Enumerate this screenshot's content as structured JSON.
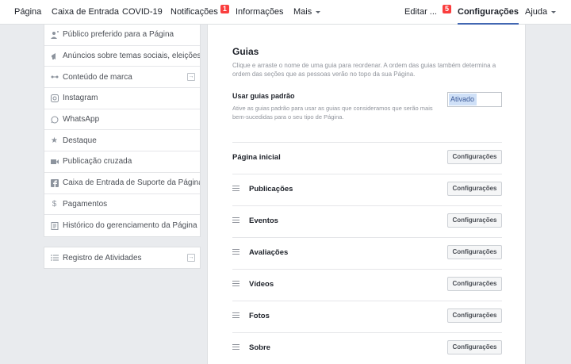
{
  "topnav": {
    "items": [
      {
        "label": "Página"
      },
      {
        "label": "Caixa de Entrada"
      },
      {
        "label": "COVID-19"
      },
      {
        "label": "Notificações",
        "badge": "1"
      },
      {
        "label": "Informações"
      },
      {
        "label": "Mais"
      }
    ],
    "right": [
      {
        "label": "Editar ...",
        "badge": "5"
      },
      {
        "label": "Configurações"
      },
      {
        "label": "Ajuda"
      }
    ]
  },
  "sidebar": {
    "items": [
      {
        "label": "Público preferido para a Página",
        "icon": "audience-icon"
      },
      {
        "label": "Anúncios sobre temas sociais, eleições ou política",
        "icon": "megaphone-icon"
      },
      {
        "label": "Conteúdo de marca",
        "icon": "handshake-icon"
      },
      {
        "label": "Instagram",
        "icon": "instagram-icon"
      },
      {
        "label": "WhatsApp",
        "icon": "whatsapp-icon"
      },
      {
        "label": "Destaque",
        "icon": "star-icon"
      },
      {
        "label": "Publicação cruzada",
        "icon": "video-icon"
      },
      {
        "label": "Caixa de Entrada de Suporte da Página",
        "icon": "facebook-icon"
      },
      {
        "label": "Pagamentos",
        "icon": "dollar-icon"
      },
      {
        "label": "Histórico do gerenciamento da Página",
        "icon": "history-icon"
      }
    ],
    "activity": {
      "label": "Registro de Atividades",
      "icon": "list-icon"
    }
  },
  "main": {
    "title": "Guias",
    "description": "Clique e arraste o nome de uma guia para reordenar. A ordem das guias também determina a ordem das seções que as pessoas verão no topo da sua Página.",
    "standard_tabs": {
      "title": "Usar guias padrão",
      "description": "Ative as guias padrão para usar as guias que consideramos que serão mais bem-sucedidas para o seu tipo de Página.",
      "value": "Ativado"
    },
    "tabs": [
      {
        "name": "Página inicial",
        "button": "Configurações"
      },
      {
        "name": "Publicações",
        "button": "Configurações"
      },
      {
        "name": "Eventos",
        "button": "Configurações"
      },
      {
        "name": "Avaliações",
        "button": "Configurações"
      },
      {
        "name": "Vídeos",
        "button": "Configurações"
      },
      {
        "name": "Fotos",
        "button": "Configurações"
      },
      {
        "name": "Sobre",
        "button": "Configurações"
      }
    ]
  }
}
